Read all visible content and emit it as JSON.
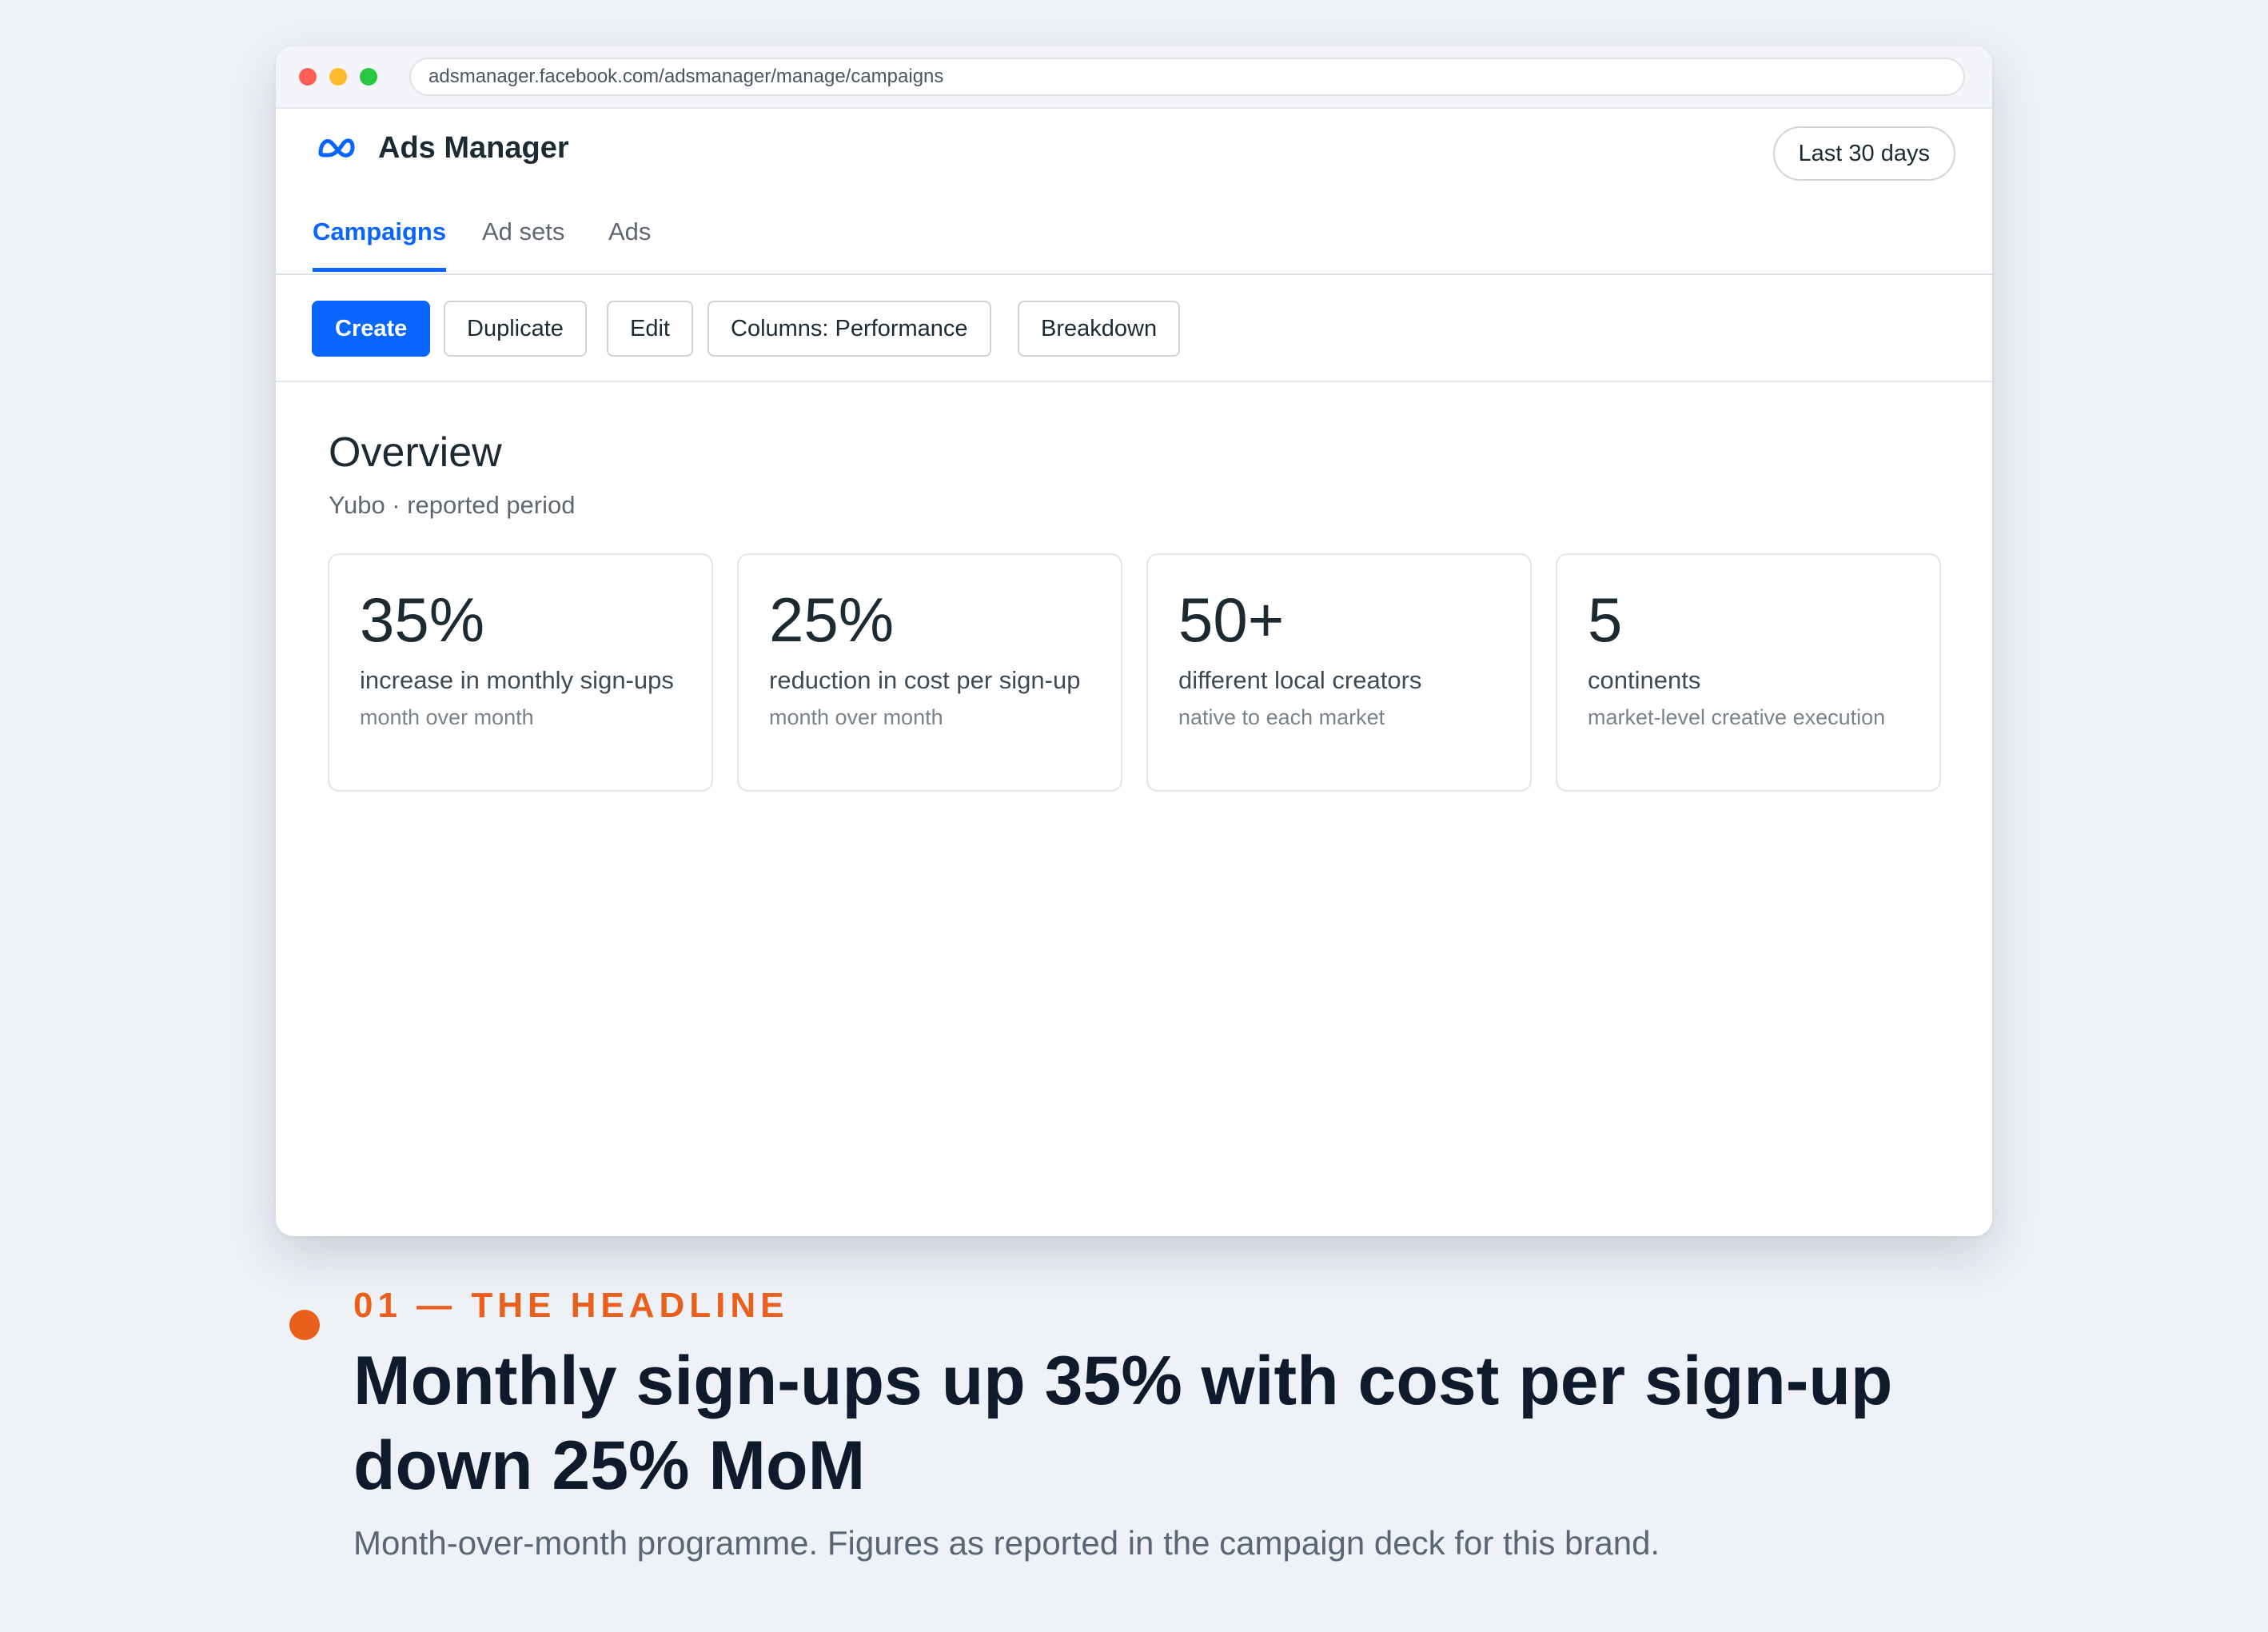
{
  "browser": {
    "url": "adsmanager.facebook.com/adsmanager/manage/campaigns"
  },
  "app": {
    "logo_icon": "meta-logo-icon",
    "title": "Ads Manager",
    "date_range": "Last 30 days",
    "accent_color": "#0866ff"
  },
  "tabs": [
    {
      "label": "Campaigns",
      "active": true
    },
    {
      "label": "Ad sets",
      "active": false
    },
    {
      "label": "Ads",
      "active": false
    }
  ],
  "toolbar": {
    "create": "Create",
    "duplicate": "Duplicate",
    "edit": "Edit",
    "columns": "Columns: Performance",
    "breakdown": "Breakdown"
  },
  "overview": {
    "title": "Overview",
    "subtitle": "Yubo · reported period",
    "cards": [
      {
        "metric": "35%",
        "label": "increase in monthly sign-ups",
        "note": "month over month"
      },
      {
        "metric": "25%",
        "label": "reduction in cost per sign-up",
        "note": "month over month"
      },
      {
        "metric": "50+",
        "label": "different local creators",
        "note": "native to each market"
      },
      {
        "metric": "5",
        "label": "continents",
        "note": "market-level creative execution"
      }
    ]
  },
  "caption": {
    "kicker": "01 — THE HEADLINE",
    "headline": "Monthly sign-ups up 35% with cost per sign-up down 25% MoM",
    "description": "Month-over-month programme. Figures as reported in the campaign deck for this brand.",
    "accent_color": "#e8601c"
  }
}
